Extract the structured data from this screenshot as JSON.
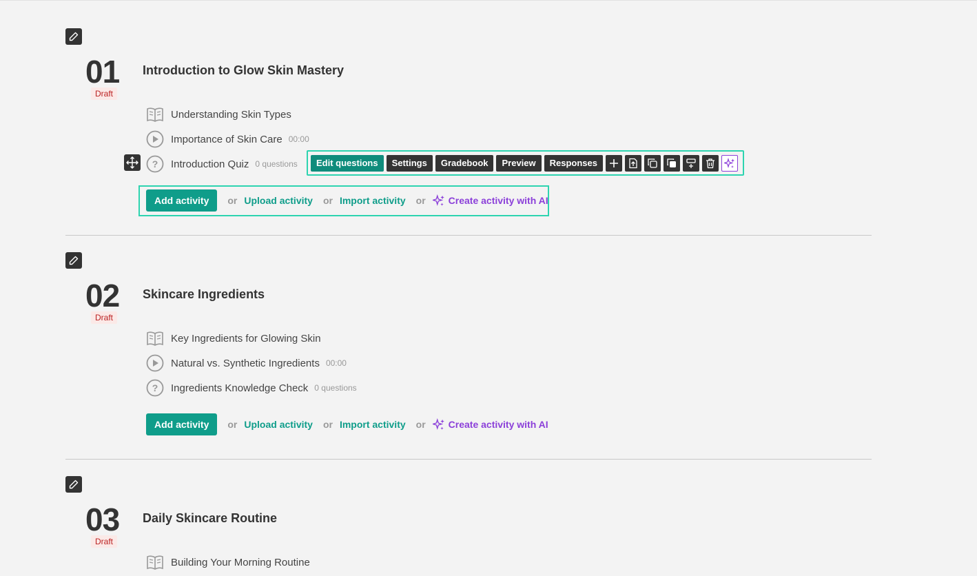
{
  "modules": [
    {
      "number": "01",
      "status": "Draft",
      "title": "Introduction to Glow Skin Mastery",
      "activities": [
        {
          "icon": "book-icon",
          "name": "Understanding Skin Types",
          "meta": ""
        },
        {
          "icon": "play-icon",
          "name": "Importance of Skin Care",
          "meta": "00:00"
        },
        {
          "icon": "question-icon",
          "name": "Introduction Quiz",
          "meta": "0 questions"
        }
      ]
    },
    {
      "number": "02",
      "status": "Draft",
      "title": "Skincare Ingredients",
      "activities": [
        {
          "icon": "book-icon",
          "name": "Key Ingredients for Glowing Skin",
          "meta": ""
        },
        {
          "icon": "play-icon",
          "name": "Natural vs. Synthetic Ingredients",
          "meta": "00:00"
        },
        {
          "icon": "question-icon",
          "name": "Ingredients Knowledge Check",
          "meta": "0 questions"
        }
      ]
    },
    {
      "number": "03",
      "status": "Draft",
      "title": "Daily Skincare Routine",
      "activities": [
        {
          "icon": "book-icon",
          "name": "Building Your Morning Routine",
          "meta": ""
        }
      ]
    }
  ],
  "toolbar": {
    "edit_questions": "Edit questions",
    "settings": "Settings",
    "gradebook": "Gradebook",
    "preview": "Preview",
    "responses": "Responses"
  },
  "add_row": {
    "add_activity": "Add activity",
    "or": "or",
    "upload_activity": "Upload activity",
    "import_activity": "Import activity",
    "create_ai": "Create activity with AI"
  },
  "colors": {
    "accent": "#0f9d8a",
    "ai": "#8b3fd9",
    "highlight": "#2dd4b0",
    "draft": "#b22222"
  }
}
